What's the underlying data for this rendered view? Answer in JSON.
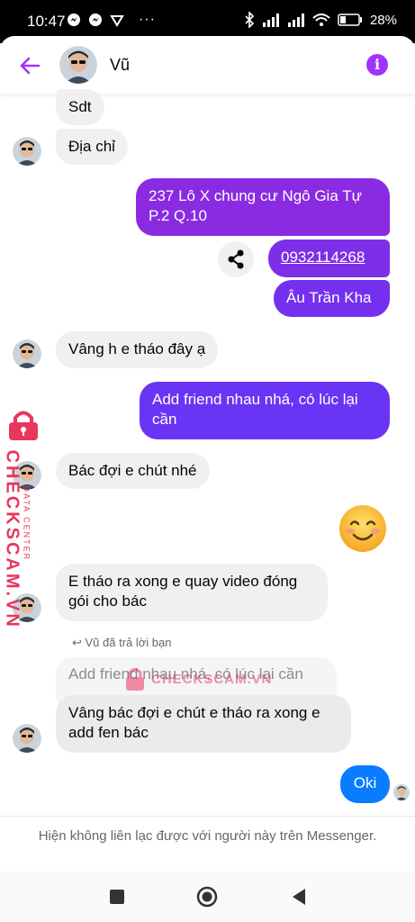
{
  "status_bar": {
    "time": "10:47",
    "battery": "28%",
    "icons": [
      "messenger-notif-icon",
      "messenger-notif-icon",
      "location-icon",
      "bluetooth-icon",
      "signal-icon",
      "signal-icon",
      "wifi-icon",
      "battery-icon"
    ]
  },
  "header": {
    "contact_name": "Vũ",
    "info_label": "i"
  },
  "messages": {
    "m1": "Sdt",
    "m2": "Địa chỉ",
    "m3": "237 Lô X chung cư Ngô Gia Tự P.2 Q.10",
    "m4": "0932114268",
    "m5": "Âu Trần Kha",
    "m6": "Vâng h e tháo đây ạ",
    "m7": "Add friend nhau nhá, có lúc lại cần",
    "m8": "Bác đợi e chút nhé",
    "m9": "E tháo ra xong e quay video đóng gói cho bác",
    "reply_label": "Vũ đã trả lời bạn",
    "quoted": "Add friend nhau nhá, có lúc lại cần",
    "m10": "Vâng bác đợi e chút e tháo ra xong e add fen bác",
    "m11": "Oki"
  },
  "watermark": {
    "side_small": "DATA CENTER",
    "side_big": "CHECKSCAM.VN",
    "center": "CHECKSCAM.VN"
  },
  "footer": {
    "note": "Hiện không liên lạc được với người này trên Messenger."
  },
  "colors": {
    "accent": "#a033ff",
    "outgoing_top": "#8a2be2",
    "outgoing_bottom": "#6a34f5",
    "blue": "#0a7cff"
  }
}
